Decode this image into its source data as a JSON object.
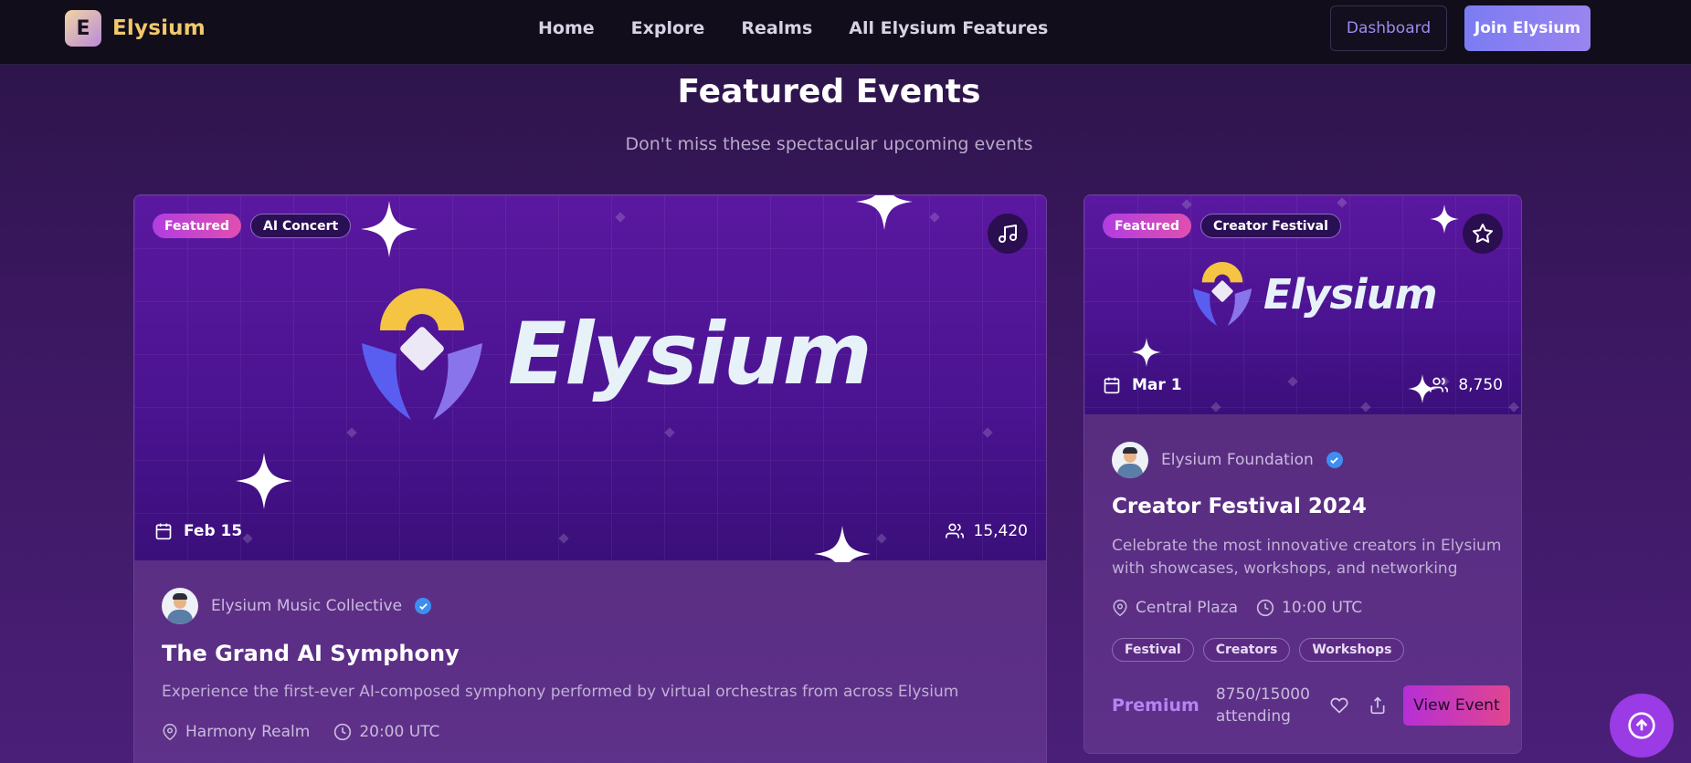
{
  "nav": {
    "logo_letter": "E",
    "brand": "Elysium",
    "links": [
      "Home",
      "Explore",
      "Realms",
      "All Elysium Features"
    ],
    "dashboard_label": "Dashboard",
    "join_label": "Join Elysium"
  },
  "section": {
    "title": "Featured Events",
    "subtitle": "Don't miss these spectacular upcoming events"
  },
  "events": [
    {
      "featured_label": "Featured",
      "category": "AI Concert",
      "corner_icon": "music-icon",
      "banner_wordmark": "Elysium",
      "date": "Feb 15",
      "attendees": "15,420",
      "creator": "Elysium Music Collective",
      "title": "The Grand AI Symphony",
      "description": "Experience the first-ever AI-composed symphony performed by virtual orchestras from across Elysium",
      "location": "Harmony Realm",
      "time": "20:00 UTC"
    },
    {
      "featured_label": "Featured",
      "category": "Creator Festival",
      "corner_icon": "star-icon",
      "banner_wordmark": "Elysium",
      "date": "Mar 1",
      "attendees": "8,750",
      "creator": "Elysium Foundation",
      "title": "Creator Festival 2024",
      "description": "Celebrate the most innovative creators in Elysium with showcases, workshops, and networking",
      "location": "Central Plaza",
      "time": "10:00 UTC",
      "tags": [
        "Festival",
        "Creators",
        "Workshops"
      ],
      "tier": "Premium",
      "attending_line1": "8750/15000",
      "attending_line2": "attending",
      "view_label": "View Event"
    }
  ],
  "colors": {
    "accent": "#9a3be6",
    "featured_pill": "#c03fd0",
    "verified": "#3d8ef0",
    "premium": "#b783f3"
  }
}
